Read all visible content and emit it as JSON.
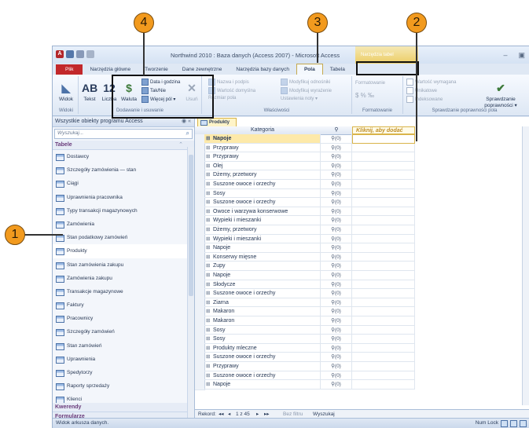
{
  "window": {
    "title": "Northwind 2010 : Baza danych (Access 2007) - Microsoft Access",
    "context_label": "Narzędzia tabel",
    "controls": [
      "–",
      "▣",
      "✕"
    ]
  },
  "ribbon_tabs": [
    "Plik",
    "Narzędzia główne",
    "Tworzenie",
    "Dane zewnętrzne",
    "Narzędzia bazy danych",
    "Pola",
    "Tabela"
  ],
  "ribbon": {
    "group_views": {
      "caption": "Widoki",
      "widok_label": "Widok"
    },
    "group_add_delete": {
      "caption": "Dodawanie i usuwanie",
      "tekst_label": "Tekst",
      "liczba_label": "Liczba",
      "waluta_label": "Waluta",
      "data_label": "Data i godzina",
      "taknie_label": "Tak/Nie",
      "wiecej_label": "Więcej pól ▾",
      "usun_label": "Usuń"
    },
    "group_properties": {
      "caption": "Właściwości",
      "nazwa_label": "Nazwa i podpis",
      "wartosc_label": "Wartość domyślna",
      "rozmiar_label": "Rozmiar pola",
      "wyrazenie_label": "Modyfikuj wyrażenie",
      "odnosniki_label": "Modyfikuj odnośniki",
      "ustawienia_label": "Ustawienia noty ▾"
    },
    "group_format": {
      "caption": "Formatowanie",
      "format_label": "Formatowanie"
    },
    "group_validation": {
      "caption": "Sprawdzanie poprawności pola",
      "wymagana_label": "Wartość wymagana",
      "unikatowe_label": "Unikatowe",
      "indeksowane_label": "Indeksowane",
      "sprawdzanie_label": "Sprawdzanie poprawności ▾"
    }
  },
  "nav": {
    "header": "Wszystkie obiekty programu Access",
    "header_controls": "◉  «",
    "search_placeholder": "Wyszukaj...",
    "section": "Tabele",
    "section_arrow": "⌃",
    "items": [
      "Dostawcy",
      "Szczegóły zamówienia — stan",
      "Ciągi",
      "Uprawnienia pracownika",
      "Typy transakcji magazynowych",
      "Zamówienia",
      "Stan podatkowy zamówień",
      "Produkty",
      "Stan zamówienia zakupu",
      "Zamówienia zakupu",
      "Transakcje magazynowe",
      "Faktury",
      "Pracownicy",
      "Szczegóły zamówień",
      "Stan zamówień",
      "Uprawnienia",
      "Spedytorzy",
      "Raporty sprzedaży",
      "Klienci",
      "Szczegóły zamówienia zakupu",
      "Komentarze",
      "Ustawy"
    ],
    "selected_index": 7,
    "bottom_sections": [
      "Kwerendy",
      "Formularze"
    ]
  },
  "document": {
    "tab_label": "Produkty",
    "columns": {
      "category": "Kategoria",
      "attachment": "⚲",
      "add_field": "Kliknij, aby dodać"
    },
    "attachment_value": "(0)",
    "rows": [
      "Napoje",
      "Przyprawy",
      "Przyprawy",
      "Olej",
      "Dżemy, przetwory",
      "Suszone owoce i orzechy",
      "Sosy",
      "Suszone owoce i orzechy",
      "Owoce i warzywa konserwowe",
      "Wypieki i mieszanki",
      "Dżemy, przetwory",
      "Wypieki i mieszanki",
      "Napoje",
      "Konserwy mięsne",
      "Zupy",
      "Napoje",
      "Słodycze",
      "Suszone owoce i orzechy",
      "Ziarna",
      "Makaron",
      "Makaron",
      "Sosy",
      "Sosy",
      "Produkty mleczne",
      "Suszone owoce i orzechy",
      "Przyprawy",
      "Suszone owoce i orzechy",
      "Napoje"
    ]
  },
  "record_nav": {
    "label": "Rekord:",
    "first": "◂◂",
    "prev": "◂",
    "position": "1 z 45",
    "next": "▸",
    "last": "▸▸",
    "filter": "Bez filtru",
    "search": "Wyszukaj"
  },
  "status": {
    "left": "Widok arkusza danych.",
    "right": "Num Lock"
  },
  "callouts": [
    "1",
    "2",
    "3",
    "4"
  ],
  "colors": {
    "accent_orange": "#f29a1e",
    "file_tab": "#c2282b",
    "selected_cell": "#fde9a9"
  }
}
